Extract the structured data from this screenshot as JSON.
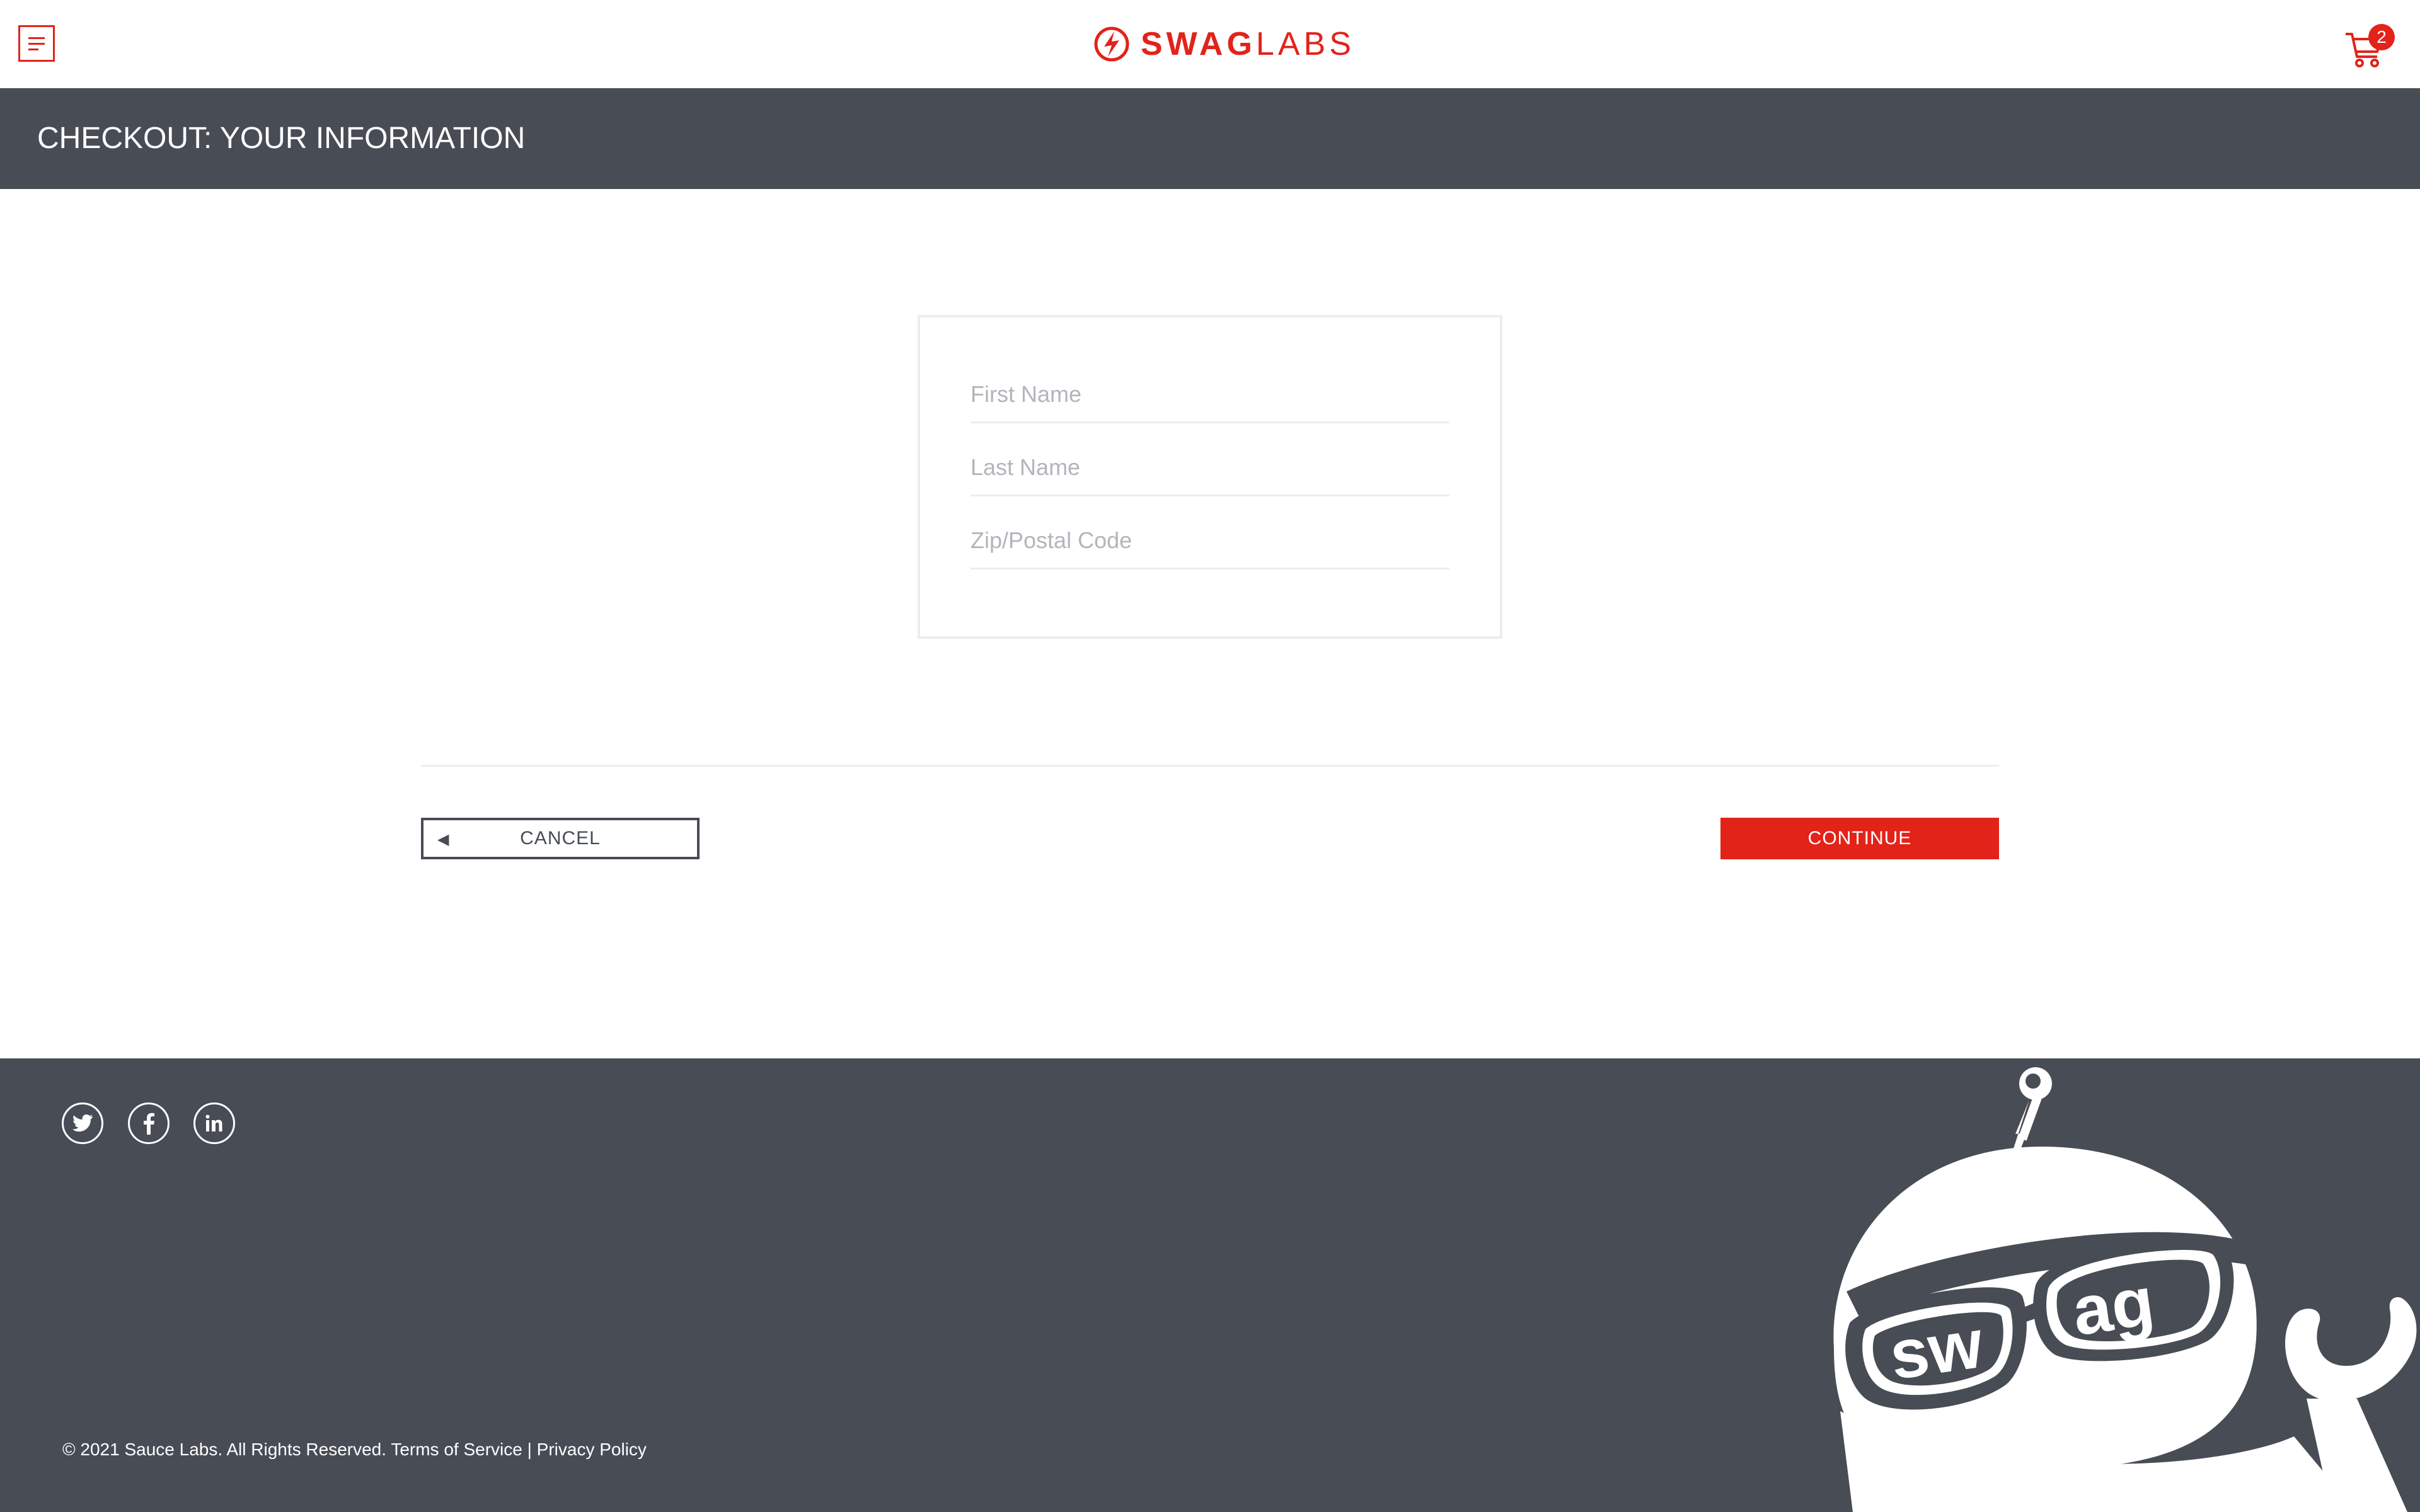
{
  "header": {
    "menu_icon": "hamburger-menu-icon",
    "logo": {
      "strong": "SWAG",
      "light": "LABS",
      "icon": "swaglabs-bolt-icon"
    },
    "cart": {
      "icon": "shopping-cart-icon",
      "badge_count": "2"
    }
  },
  "subheader": {
    "title": "CHECKOUT: YOUR INFORMATION"
  },
  "form": {
    "first_name": {
      "placeholder": "First Name",
      "value": ""
    },
    "last_name": {
      "placeholder": "Last Name",
      "value": ""
    },
    "postal_code": {
      "placeholder": "Zip/Postal Code",
      "value": ""
    }
  },
  "actions": {
    "cancel_label": "CANCEL",
    "cancel_icon": "back-arrow-icon",
    "continue_label": "CONTINUE"
  },
  "footer": {
    "social": [
      "twitter-icon",
      "facebook-icon",
      "linkedin-icon"
    ],
    "copyright": "© 2021 Sauce Labs. All Rights Reserved.",
    "terms": "Terms of Service",
    "separator": "|",
    "privacy": "Privacy Policy",
    "mascot": "swag-robot-mascot",
    "mascot_text": "swag"
  },
  "colors": {
    "accent": "#e2231a",
    "dark": "#474c55",
    "border": "#ededef",
    "placeholder": "#b3b5bb"
  }
}
